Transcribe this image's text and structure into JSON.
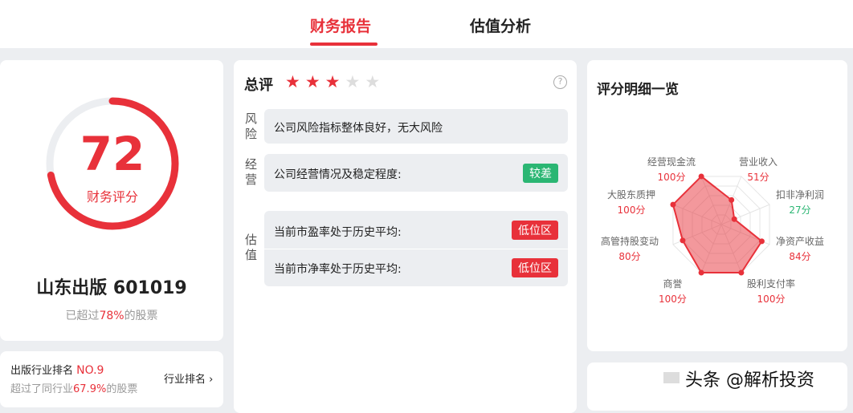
{
  "tabs": [
    {
      "label": "财务报告",
      "active": true
    },
    {
      "label": "估值分析",
      "active": false
    }
  ],
  "score": {
    "value": "72",
    "label": "财务评分",
    "progress": 0.72
  },
  "stock": {
    "name": "山东出版 601019",
    "beat_prefix": "已超过",
    "beat_pct": "78%",
    "beat_suffix": "的股票"
  },
  "industry": {
    "label": "出版行业排名",
    "rank": "NO.9",
    "beat_prefix": "超过了同行业",
    "beat_pct": "67.9%",
    "beat_suffix": "的股票",
    "link": "行业排名"
  },
  "summary": {
    "title": "总评",
    "stars": 3,
    "max_stars": 5,
    "risk": {
      "label": "风险",
      "text": "公司风险指标整体良好，无大风险"
    },
    "operation": {
      "label": "经营",
      "text": "公司经营情况及稳定程度:",
      "badge": "较差"
    },
    "valuation": {
      "label": "估值",
      "rows": [
        {
          "text": "当前市盈率处于历史平均:",
          "badge": "低位区"
        },
        {
          "text": "当前市净率处于历史平均:",
          "badge": "低位区"
        }
      ]
    }
  },
  "radar": {
    "title": "评分明细一览",
    "items": [
      {
        "name": "经营现金流",
        "score": "100分",
        "value": 100
      },
      {
        "name": "营业收入",
        "score": "51分",
        "value": 51
      },
      {
        "name": "扣非净利润",
        "score": "27分",
        "value": 27
      },
      {
        "name": "净资产收益",
        "score": "84分",
        "value": 84
      },
      {
        "name": "股利支付率",
        "score": "100分",
        "value": 100
      },
      {
        "name": "商誉",
        "score": "100分",
        "value": 100
      },
      {
        "name": "高管持股变动",
        "score": "80分",
        "value": 80
      },
      {
        "name": "大股东质押",
        "score": "100分",
        "value": 100
      }
    ]
  },
  "watermark": "头条 @解析投资",
  "colors": {
    "accent": "#e8313a",
    "good": "#2bb673"
  }
}
